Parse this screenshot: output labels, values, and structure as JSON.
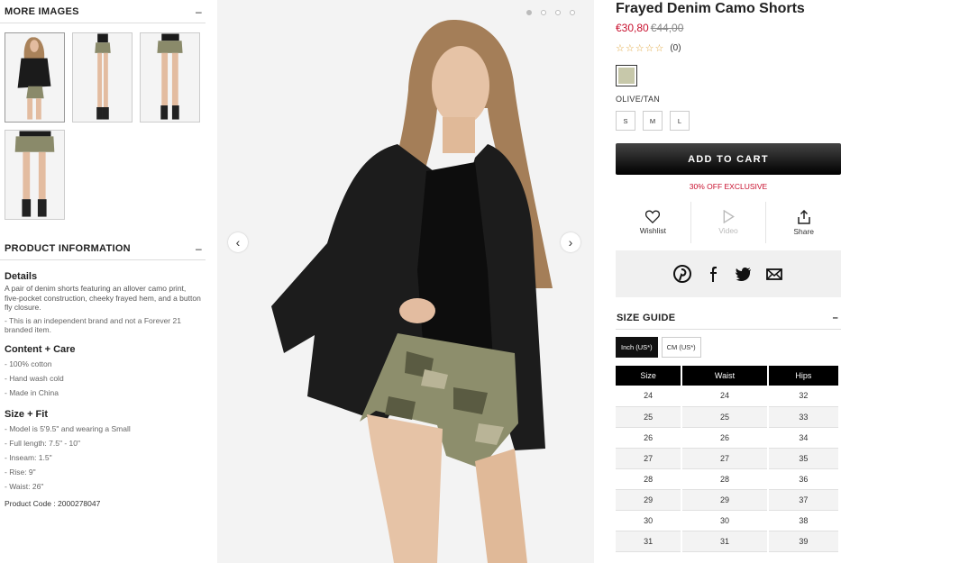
{
  "more_images": {
    "title": "MORE IMAGES",
    "toggle": "–",
    "thumbnails": [
      "front-jacket",
      "side",
      "back",
      "front-close"
    ]
  },
  "product_info": {
    "title": "PRODUCT INFORMATION",
    "toggle": "–",
    "details_heading": "Details",
    "details_text": "A pair of denim shorts featuring an allover camo print, five-pocket construction, cheeky frayed hem, and a button fly closure.",
    "details_note": "- This is an independent brand and not a Forever 21 branded item.",
    "content_heading": "Content + Care",
    "content_items": [
      "- 100% cotton",
      "- Hand wash cold",
      "- Made in China"
    ],
    "size_heading": "Size + Fit",
    "size_items": [
      "- Model is 5'9.5\" and wearing a Small",
      "- Full length: 7.5\" - 10\"",
      "- Inseam: 1.5\"",
      "- Rise: 9\"",
      "- Waist: 26\""
    ],
    "product_code": "Product Code : 2000278047"
  },
  "gallery": {
    "prev": "‹",
    "next": "›",
    "dots": 4,
    "active_dot": 0
  },
  "product": {
    "title": "Frayed Denim Camo Shorts",
    "price_now": "€30,80",
    "price_was": "€44,00",
    "stars": "☆☆☆☆☆",
    "review_count": "(0)",
    "color_name": "OLIVE/TAN",
    "swatch_color": "#c7c8aa",
    "sizes": [
      "S",
      "M",
      "L"
    ],
    "add_to_cart": "ADD TO CART",
    "exclusive": "30% OFF EXCLUSIVE",
    "wishlist": "Wishlist",
    "video": "Video",
    "share": "Share"
  },
  "size_guide": {
    "title": "SIZE GUIDE",
    "toggle": "–",
    "unit_inch": "Inch (US*)",
    "unit_cm": "CM (US*)",
    "columns": [
      "Size",
      "Waist",
      "Hips"
    ],
    "rows": [
      [
        "24",
        "24",
        "32"
      ],
      [
        "25",
        "25",
        "33"
      ],
      [
        "26",
        "26",
        "34"
      ],
      [
        "27",
        "27",
        "35"
      ],
      [
        "28",
        "28",
        "36"
      ],
      [
        "29",
        "29",
        "37"
      ],
      [
        "30",
        "30",
        "38"
      ],
      [
        "31",
        "31",
        "39"
      ]
    ]
  },
  "colors": {
    "accent_red": "#c8102e",
    "cart_bg": "#000000"
  }
}
